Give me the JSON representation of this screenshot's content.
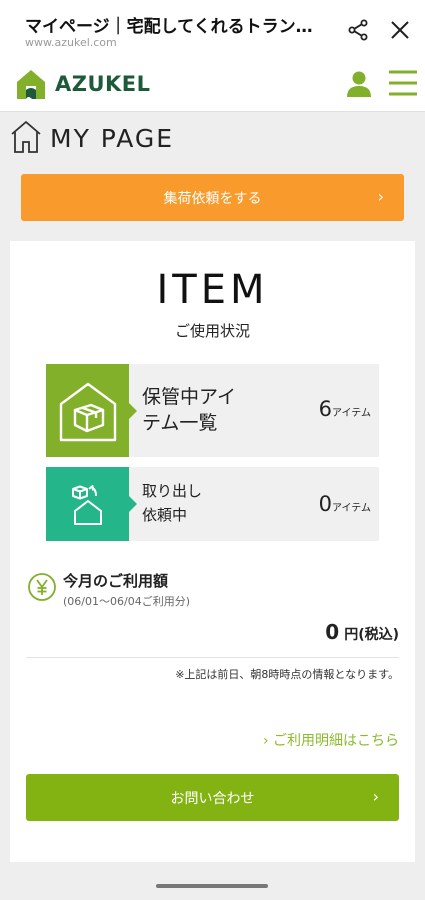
{
  "browser": {
    "title": "マイページ｜宅配してくれるトランク…",
    "url": "www.azukel.com"
  },
  "header": {
    "logo_text": "AZUKEL",
    "brand_color": "#83b02a"
  },
  "page": {
    "title": "MY PAGE"
  },
  "pickup": {
    "label": "集荷依頼をする",
    "chevron": "›",
    "color": "#f89a2c"
  },
  "item_section": {
    "title": "ITEM",
    "subtitle": "ご使用状況",
    "stored": {
      "label_line1": "保管中アイ",
      "label_line2": "テム一覧",
      "count": "6",
      "unit": "アイテム",
      "icon": "house-box-icon",
      "color": "#83b02a"
    },
    "retrieval": {
      "label_line1": "取り出し",
      "label_line2": "依頼中",
      "count": "0",
      "unit": "アイテム",
      "icon": "box-delivery-icon",
      "color": "#25b58a"
    }
  },
  "usage": {
    "title": "今月のご利用額",
    "period": "(06/01〜06/04ご利用分)",
    "amount": "0",
    "currency": "円(税込)",
    "note": "※上記は前日、朝8時時点の情報となります。",
    "detail_link": "ご利用明細はこちら",
    "detail_chevron": "›"
  },
  "contact": {
    "label": "お問い合わせ",
    "chevron": "›",
    "color": "#83b313"
  }
}
